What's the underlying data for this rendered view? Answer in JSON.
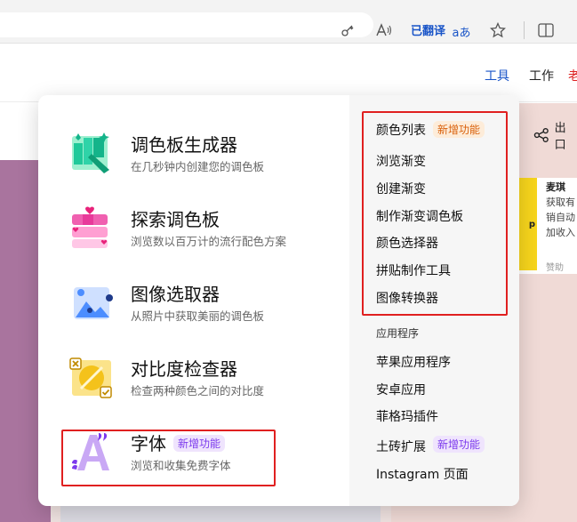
{
  "browser": {
    "translated_label": "已翻译",
    "immersive_label": "aあ",
    "icons": [
      "key-icon",
      "read-aloud-icon",
      "translate-icon",
      "favorite-star-icon",
      "split-screen-icon"
    ]
  },
  "header": {
    "nav": [
      {
        "label": "工具",
        "active": true
      },
      {
        "label": "工作",
        "active": false
      }
    ],
    "nav_cut": "老"
  },
  "background": {
    "share_label": "出口",
    "ad": {
      "logo_text": "p",
      "title": "麦琪",
      "lines": [
        "获取有",
        "销自动",
        "加收入"
      ],
      "footer": "赞助"
    }
  },
  "menu": {
    "left_items": [
      {
        "id": "palette-generator",
        "title": "调色板生成器",
        "desc": "在几秒钟内创建您的调色板",
        "icon": "palette-generator-icon"
      },
      {
        "id": "explore-palettes",
        "title": "探索调色板",
        "desc": "浏览数以百万计的流行配色方案",
        "icon": "explore-palettes-icon"
      },
      {
        "id": "image-picker",
        "title": "图像选取器",
        "desc": "从照片中获取美丽的调色板",
        "icon": "image-picker-icon"
      },
      {
        "id": "contrast-checker",
        "title": "对比度检查器",
        "desc": "检查两种颜色之间的对比度",
        "icon": "contrast-checker-icon"
      },
      {
        "id": "fonts",
        "title": "字体",
        "desc": "浏览和收集免费字体",
        "icon": "fonts-icon",
        "badge": "新增功能"
      }
    ],
    "right_links": [
      {
        "label": "颜色列表",
        "badge": "新增功能"
      },
      {
        "label": "浏览渐变"
      },
      {
        "label": "创建渐变"
      },
      {
        "label": "制作渐变调色板"
      },
      {
        "label": "颜色选择器"
      },
      {
        "label": "拼贴制作工具"
      },
      {
        "label": "图像转换器"
      }
    ],
    "apps_section": "应用程序",
    "app_links": [
      {
        "label": "苹果应用程序"
      },
      {
        "label": "安卓应用"
      },
      {
        "label": "菲格玛插件"
      },
      {
        "label": "土砖扩展",
        "badge": "新增功能"
      },
      {
        "label": "Instagram 页面"
      }
    ]
  },
  "colors": {
    "accent_blue": "#1a55c8",
    "badge_purple": "#7c3aed",
    "badge_orange": "#d9600b",
    "highlight_red": "#e02020"
  }
}
